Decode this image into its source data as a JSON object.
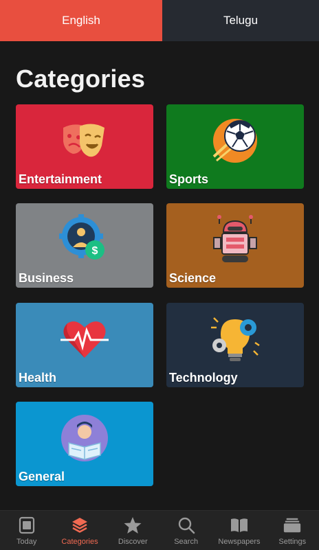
{
  "language_tabs": [
    {
      "label": "English",
      "active": true
    },
    {
      "label": "Telugu",
      "active": false
    }
  ],
  "page_title": "Categories",
  "categories": [
    {
      "label": "Entertainment",
      "color": "#d9263c",
      "icon": "theater-masks-icon"
    },
    {
      "label": "Sports",
      "color": "#0f7a1e",
      "icon": "soccer-ball-icon"
    },
    {
      "label": "Business",
      "color": "#808386",
      "icon": "business-gear-icon"
    },
    {
      "label": "Science",
      "color": "#a5601f",
      "icon": "robot-icon"
    },
    {
      "label": "Health",
      "color": "#3a8bb9",
      "icon": "heartbeat-icon"
    },
    {
      "label": "Technology",
      "color": "#222f40",
      "icon": "lightbulb-gears-icon"
    },
    {
      "label": "General",
      "color": "#0b96d0",
      "icon": "newspaper-reader-icon"
    }
  ],
  "bottom_nav": [
    {
      "label": "Today",
      "icon": "today-icon",
      "active": false
    },
    {
      "label": "Categories",
      "icon": "layers-icon",
      "active": true
    },
    {
      "label": "Discover",
      "icon": "star-icon",
      "active": false
    },
    {
      "label": "Search",
      "icon": "search-icon",
      "active": false
    },
    {
      "label": "Newspapers",
      "icon": "book-icon",
      "active": false
    },
    {
      "label": "Settings",
      "icon": "settings-stack-icon",
      "active": false
    }
  ],
  "colors": {
    "accent": "#e84f3f",
    "background": "#181818",
    "nav_background": "#242424",
    "inactive_tab": "#262a31"
  }
}
